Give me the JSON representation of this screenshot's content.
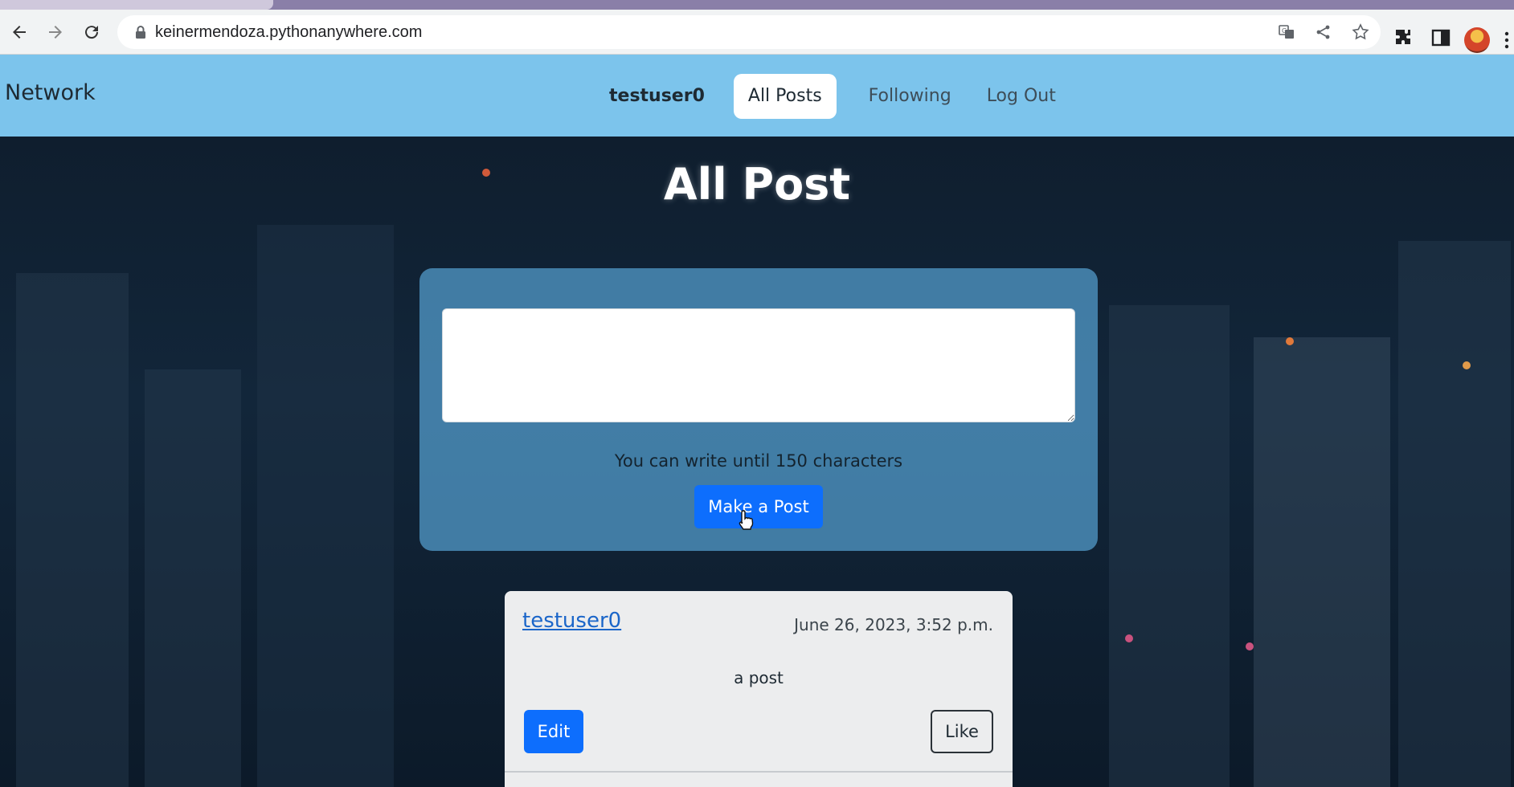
{
  "browser": {
    "url": "keinermendoza.pythonanywhere.com",
    "icons": [
      "back-arrow-icon",
      "forward-arrow-icon",
      "reload-icon",
      "lock-icon",
      "translate-icon",
      "share-icon",
      "star-icon",
      "extensions-icon",
      "side-panel-icon",
      "profile-avatar",
      "menu-dots-icon"
    ]
  },
  "navbar": {
    "brand": "Network",
    "user": "testuser0",
    "links": [
      "All Posts",
      "Following",
      "Log Out"
    ],
    "active_link": "All Posts",
    "background": "#7cc4ec"
  },
  "page": {
    "title": "All Post"
  },
  "compose": {
    "placeholder": "",
    "hint": "You can write until 150 characters",
    "button_label": "Make a Post",
    "button_color": "#0d6efd"
  },
  "posts": [
    {
      "user": "testuser0",
      "date": "June 26, 2023, 3:52 p.m.",
      "content": "a post",
      "edit_label": "Edit",
      "like_label": "Like"
    }
  ]
}
